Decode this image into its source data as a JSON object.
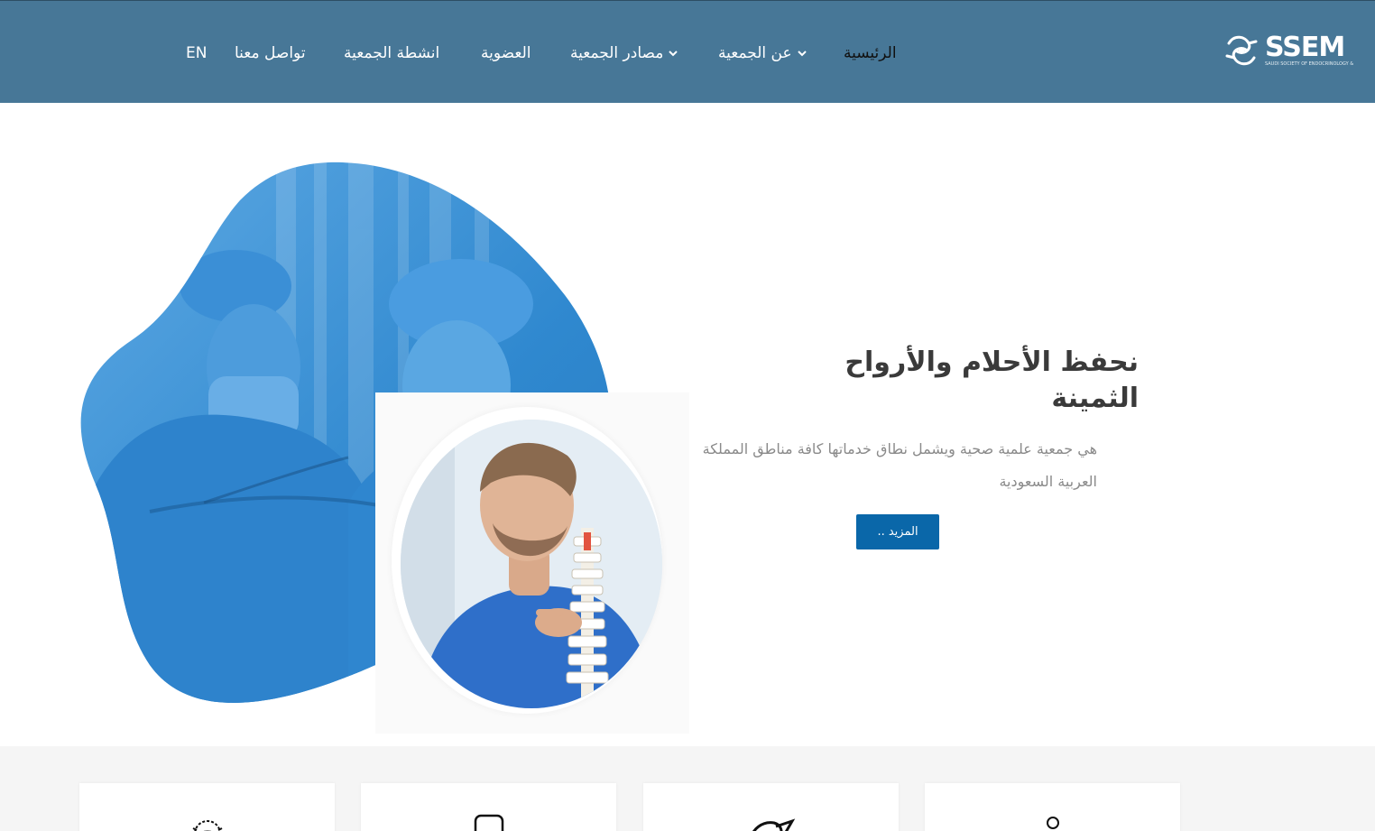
{
  "header": {
    "logo": {
      "brand": "SSEM",
      "tagline": "SAUDI SOCIETY OF ENDOCRINOLOGY & METABOLISM"
    },
    "nav": [
      {
        "label": "الرئيسية",
        "active": true,
        "dropdown": false
      },
      {
        "label": "عن الجمعية",
        "active": false,
        "dropdown": true
      },
      {
        "label": "مصادر الجمعية",
        "active": false,
        "dropdown": true
      },
      {
        "label": "العضوية",
        "active": false,
        "dropdown": false
      },
      {
        "label": "انشطة الجمعية",
        "active": false,
        "dropdown": false
      },
      {
        "label": "تواصل معنا",
        "active": false,
        "dropdown": false
      },
      {
        "label": "EN",
        "active": false,
        "dropdown": false
      }
    ]
  },
  "hero": {
    "title": "نحفظ الأحلام والأرواح الثمينة",
    "description": "هي جمعية علمية صحية ويشمل نطاق خدماتها كافة مناطق المملكة العربية السعودية",
    "button_label": "المزيد .."
  },
  "cards": [
    {
      "icon": "handshake-icon"
    },
    {
      "icon": "cube-icon"
    },
    {
      "icon": "brain-icon"
    },
    {
      "icon": "person-icon"
    }
  ],
  "colors": {
    "header_bg": "#477797",
    "button_bg": "#0a67a9",
    "section_bg": "#f5f5f5"
  }
}
